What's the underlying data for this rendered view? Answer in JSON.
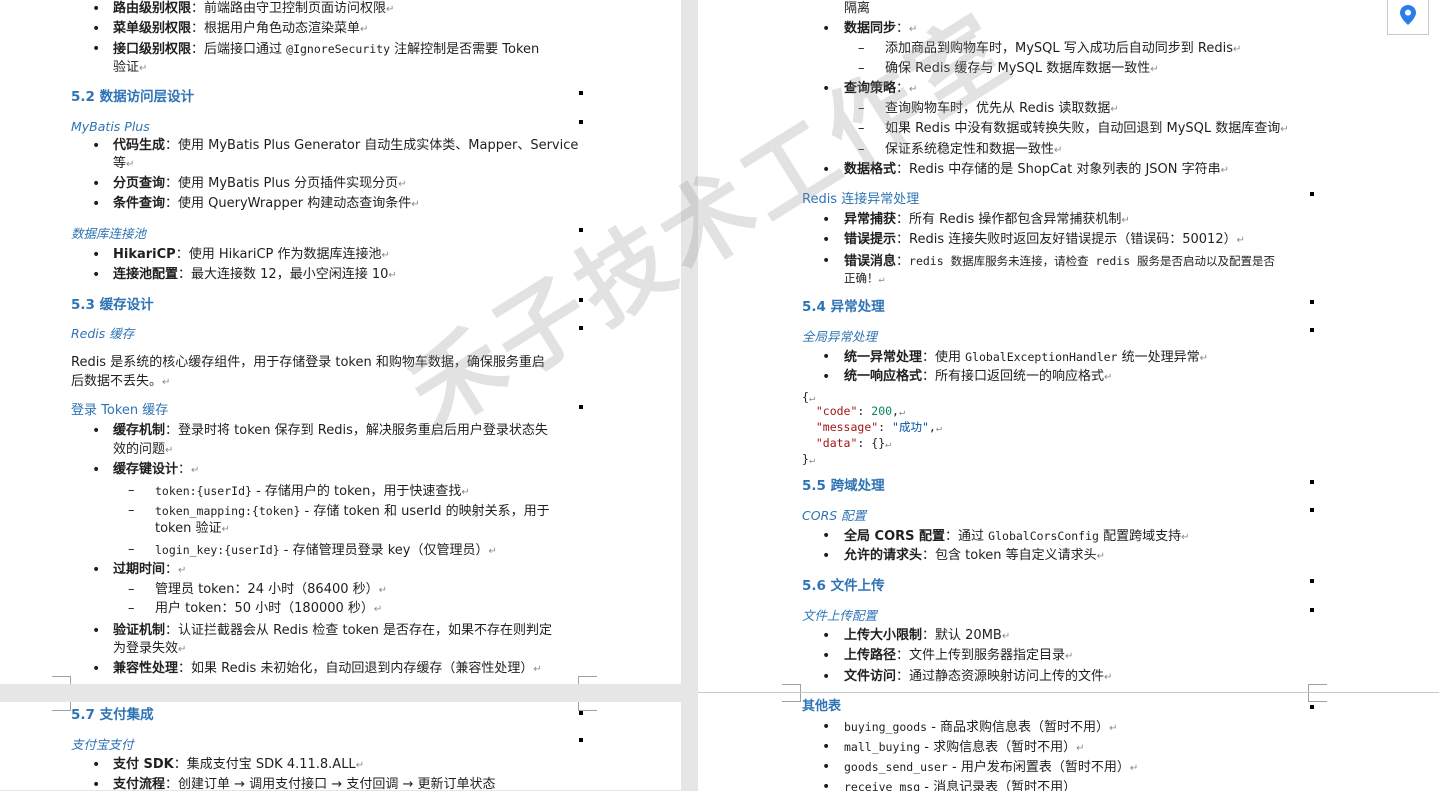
{
  "p1": {
    "perm_items": [
      {
        "label": "路由级别权限",
        "text": "：前端路由守卫控制页面访问权限"
      },
      {
        "label": "菜单级别权限",
        "text": "：根据用户角色动态渲染菜单"
      },
      {
        "label": "接口级别权限",
        "text": "：后端接口通过 ",
        "code": "@IgnoreSecurity",
        "text2": " 注解控制是否需要 Token",
        "cont": "验证"
      }
    ],
    "h52": "5.2 数据访问层设计",
    "mybatis_title": "MyBatis Plus",
    "mybatis_items": [
      {
        "label": "代码生成",
        "text": "：使用 MyBatis Plus Generator 自动生成实体类、Mapper、Service",
        "cont": "等"
      },
      {
        "label": "分页查询",
        "text": "：使用 MyBatis Plus 分页插件实现分页"
      },
      {
        "label": "条件查询",
        "text": "：使用 QueryWrapper 构建动态查询条件"
      }
    ],
    "pool_title": "数据库连接池",
    "pool_items": [
      {
        "label": "HikariCP",
        "text": "：使用 HikariCP 作为数据库连接池"
      },
      {
        "label": "连接池配置",
        "text": "：最大连接数 12，最小空闲连接 10"
      }
    ],
    "h53": "5.3 缓存设计",
    "redis_title": "Redis 缓存",
    "redis_para_1": "Redis 是系统的核心缓存组件，用于存储登录 token 和购物车数据，确保服务重启",
    "redis_para_2": "后数据不丢失。",
    "token_title": "登录 Token 缓存",
    "cache_mech": {
      "label": "缓存机制",
      "text": "：登录时将 token 保存到 Redis，解决服务重启后用户登录状态失",
      "cont": "效的问题"
    },
    "cache_key": {
      "label": "缓存键设计",
      "text": "："
    },
    "keys": [
      {
        "code": "token:{userId}",
        "text": " - 存储用户的 token，用于快速查找"
      },
      {
        "code": "token_mapping:{token}",
        "text": " - 存储 token 和 userId 的映射关系，用于",
        "cont": "token 验证"
      },
      {
        "code": "login_key:{userId}",
        "text": " - 存储管理员登录 key（仅管理员）"
      }
    ],
    "expire": {
      "label": "过期时间",
      "text": "："
    },
    "expire_items": [
      "管理员 token：24 小时（86400 秒）",
      "用户 token：50 小时（180000 秒）"
    ],
    "verify": {
      "label": "验证机制",
      "text": "：认证拦截器会从 Redis 检查 token 是否存在，如果不存在则判定",
      "cont": "为登录失效"
    },
    "compat": {
      "label": "兼容性处理",
      "text": "：如果 Redis 未初始化，自动回退到内存缓存（兼容性处理）"
    }
  },
  "p2": {
    "isolation": "隔离",
    "sync": {
      "label": "数据同步",
      "text": "："
    },
    "sync_items": [
      "添加商品到购物车时，MySQL 写入成功后自动同步到 Redis",
      "确保 Redis 缓存与 MySQL 数据库数据一致性"
    ],
    "query": {
      "label": "查询策略",
      "text": "："
    },
    "query_items": [
      "查询购物车时，优先从 Redis 读取数据",
      "如果 Redis 中没有数据或转换失败，自动回退到 MySQL 数据库查询",
      "保证系统稳定性和数据一致性"
    ],
    "format": {
      "label": "数据格式",
      "text": "：Redis 中存储的是 ShopCat 对象列表的 JSON 字符串"
    },
    "redis_err_title": "Redis 连接异常处理",
    "err_items": [
      {
        "label": "异常捕获",
        "text": "：所有 Redis 操作都包含异常捕获机制"
      },
      {
        "label": "错误提示",
        "text": "：Redis 连接失败时返回友好错误提示（错误码：50012）"
      },
      {
        "label": "错误消息",
        "text": "：",
        "code": "redis 数据库服务未连接，请检查 redis 服务是否启动以及配置是否",
        "cont": "正确！"
      }
    ],
    "h54": "5.4 异常处理",
    "global_title": "全局异常处理",
    "global_items": [
      {
        "label": "统一异常处理",
        "text": "：使用 ",
        "code": "GlobalExceptionHandler",
        "text2": " 统一处理异常"
      },
      {
        "label": "统一响应格式",
        "text": "：所有接口返回统一的响应格式"
      }
    ],
    "json_open": "{",
    "json_lines": [
      {
        "key": "\"code\"",
        "val": "200",
        "vtype": "n"
      },
      {
        "key": "\"message\"",
        "val": "\"成功\"",
        "vtype": "s"
      },
      {
        "key": "\"data\"",
        "val": "{}",
        "vtype": "p"
      }
    ],
    "json_close": "}",
    "h55": "5.5 跨域处理",
    "cors_title": "CORS 配置",
    "cors_items": [
      {
        "label": "全局 CORS 配置",
        "text": "：通过 ",
        "code": "GlobalCorsConfig",
        "text2": " 配置跨域支持"
      },
      {
        "label": "允许的请求头",
        "text": "：包含 token 等自定义请求头"
      }
    ],
    "h56": "5.6 文件上传",
    "upload_title": "文件上传配置",
    "upload_items": [
      {
        "label": "上传大小限制",
        "text": "：默认 20MB"
      },
      {
        "label": "上传路径",
        "text": "：文件上传到服务器指定目录"
      },
      {
        "label": "文件访问",
        "text": "：通过静态资源映射访问上传的文件"
      }
    ]
  },
  "p3": {
    "h57": "5.7 支付集成",
    "alipay_title": "支付宝支付",
    "pay_items": [
      {
        "label": "支付 SDK",
        "text": "：集成支付宝 SDK 4.11.8.ALL"
      },
      {
        "label": "支付流程",
        "text": "：创建订单 → 调用支付接口 → 支付回调 → 更新订单状态"
      }
    ]
  },
  "p4": {
    "other_title": "其他表",
    "tables": [
      {
        "code": "buying_goods",
        "text": " - 商品求购信息表（暂时不用）"
      },
      {
        "code": "mall_buying",
        "text": " - 求购信息表（暂时不用）"
      },
      {
        "code": "goods_send_user",
        "text": " - 用户发布闲置表（暂时不用）"
      },
      {
        "code": "receive_msg",
        "text": " - 消息记录表（暂时不用）"
      }
    ]
  },
  "watermark": "禾子技术工作室",
  "icons": {
    "location": "map-pin-icon"
  },
  "colors": {
    "heading": "#2e74b5",
    "watermark": "#969696",
    "pin": "#2b7de9"
  }
}
